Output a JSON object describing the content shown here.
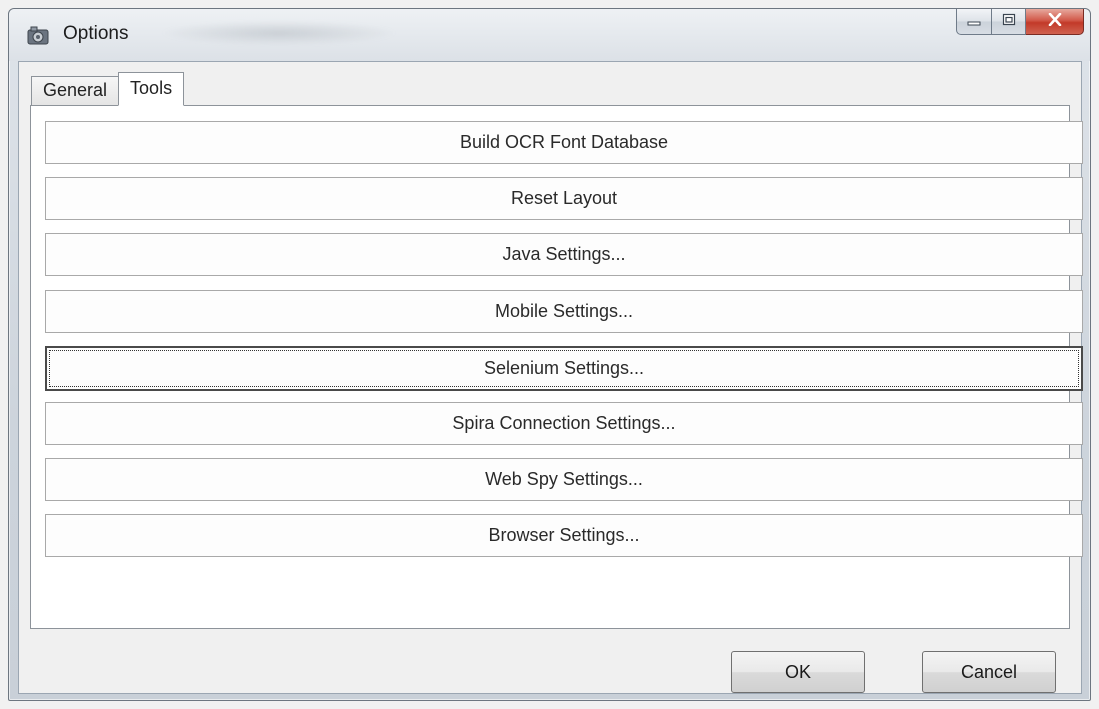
{
  "window": {
    "title": "Options"
  },
  "tabs": [
    {
      "label": "General",
      "active": false
    },
    {
      "label": "Tools",
      "active": true
    }
  ],
  "tools": {
    "buttons": [
      {
        "label": "Build OCR Font Database",
        "focused": false
      },
      {
        "label": "Reset Layout",
        "focused": false
      },
      {
        "label": "Java Settings...",
        "focused": false
      },
      {
        "label": "Mobile Settings...",
        "focused": false
      },
      {
        "label": "Selenium Settings...",
        "focused": true
      },
      {
        "label": "Spira Connection Settings...",
        "focused": false
      },
      {
        "label": "Web Spy Settings...",
        "focused": false
      },
      {
        "label": "Browser Settings...",
        "focused": false
      }
    ]
  },
  "footer": {
    "ok_label": "OK",
    "cancel_label": "Cancel"
  },
  "icons": {
    "app": "options-gear-icon",
    "minimize": "minimize-icon",
    "maximize": "maximize-icon",
    "close": "close-icon"
  },
  "colors": {
    "close_button": "#c23a29",
    "panel_background": "#ffffff",
    "dialog_background": "#f0f0f0"
  }
}
